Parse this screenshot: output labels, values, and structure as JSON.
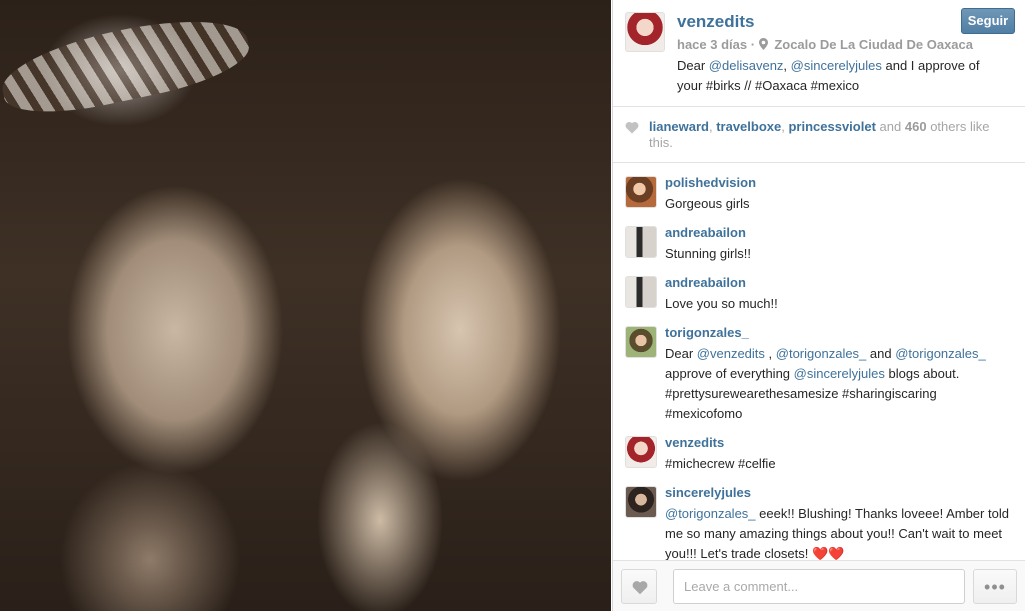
{
  "post": {
    "username": "venzedits",
    "follow_label": "Seguir",
    "time_ago": "hace 3 días",
    "location": "Zocalo De La Ciudad De Oaxaca",
    "caption_parts": [
      {
        "text": "Dear ",
        "mention": false
      },
      {
        "text": "@delisavenz",
        "mention": true
      },
      {
        "text": ", ",
        "mention": false
      },
      {
        "text": "@sincerelyjules",
        "mention": true
      },
      {
        "text": " and I approve of your #birks // #Oaxaca #mexico",
        "mention": false
      }
    ]
  },
  "likes": {
    "user1": "lianeward",
    "user2": "travelboxe",
    "user3": "princessviolet",
    "and_text": "and",
    "count": "460",
    "suffix": "others like this."
  },
  "comments": [
    {
      "user": "polishedvision",
      "avatar": "av-polished",
      "parts": [
        {
          "text": "Gorgeous girls",
          "mention": false
        }
      ]
    },
    {
      "user": "andreabailon",
      "avatar": "av-andrea",
      "parts": [
        {
          "text": "Stunning girls!!",
          "mention": false
        }
      ]
    },
    {
      "user": "andreabailon",
      "avatar": "av-andrea",
      "parts": [
        {
          "text": "Love you so much!!",
          "mention": false
        }
      ]
    },
    {
      "user": "torigonzales_",
      "avatar": "av-tori",
      "parts": [
        {
          "text": "Dear ",
          "mention": false
        },
        {
          "text": "@venzedits",
          "mention": true
        },
        {
          "text": " , ",
          "mention": false
        },
        {
          "text": "@torigonzales_",
          "mention": true
        },
        {
          "text": " and ",
          "mention": false
        },
        {
          "text": "@torigonzales_",
          "mention": true
        },
        {
          "text": " approve of everything ",
          "mention": false
        },
        {
          "text": "@sincerelyjules",
          "mention": true
        },
        {
          "text": " blogs about. #prettysurewearethesamesize #sharingiscaring #mexicofomo",
          "mention": false
        }
      ]
    },
    {
      "user": "venzedits",
      "avatar": "av-venz",
      "parts": [
        {
          "text": "#michecrew #celfie",
          "mention": false
        }
      ]
    },
    {
      "user": "sincerelyjules",
      "avatar": "av-sincerely",
      "parts": [
        {
          "text": "@torigonzales_",
          "mention": true
        },
        {
          "text": " eeek!! Blushing! Thanks loveee! Amber told me so many amazing things about you!! Can't wait to meet you!!! Let's trade closets! ❤️❤️",
          "mention": false
        }
      ]
    }
  ],
  "footer": {
    "comment_placeholder": "Leave a comment...",
    "more_label": "•••"
  },
  "icons": {
    "location": "location-pin-icon",
    "like": "heart-icon"
  },
  "colors": {
    "link": "#3f729b",
    "follow_button": "#517fa4",
    "muted": "#9b9b9b"
  }
}
